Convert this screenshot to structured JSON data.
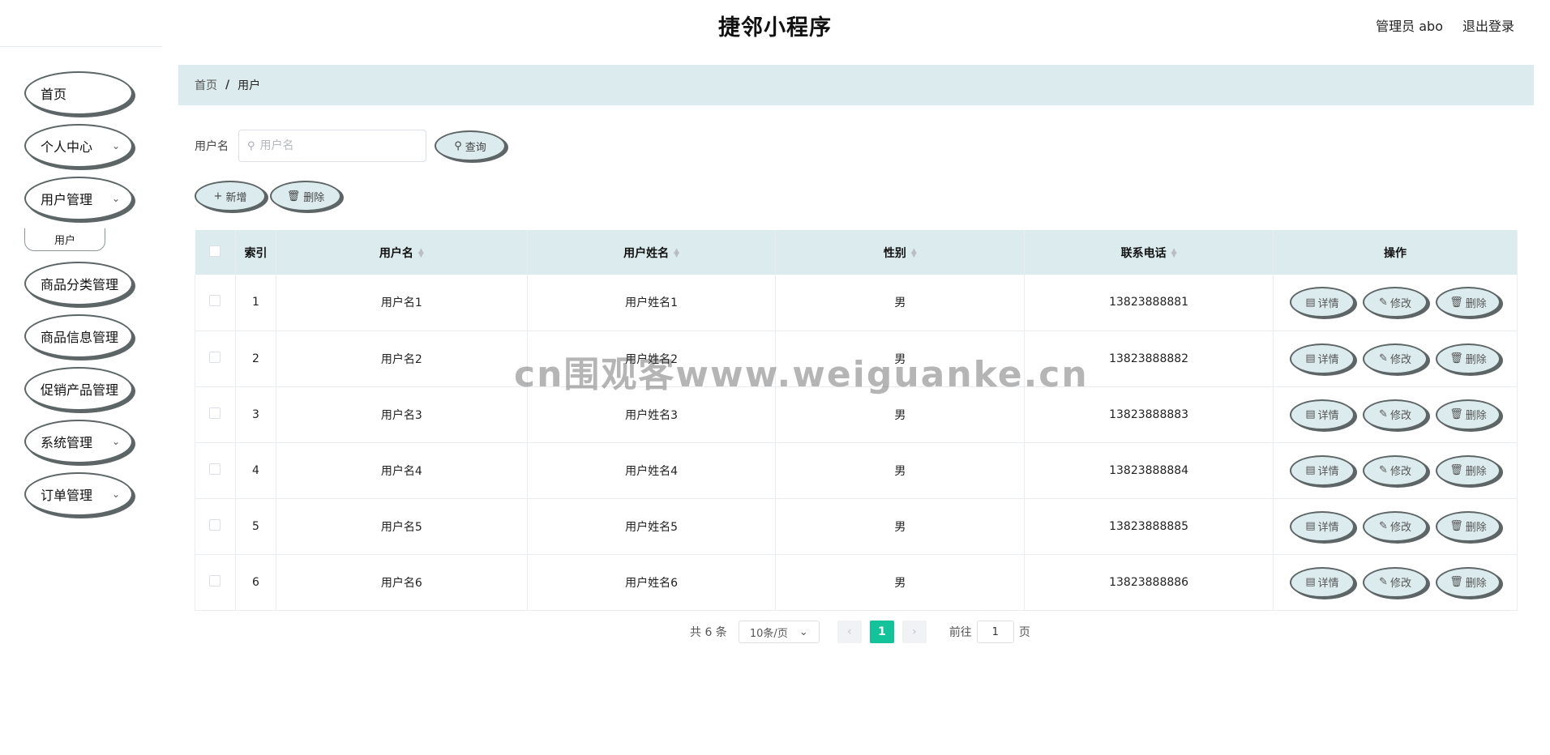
{
  "header": {
    "title": "捷邻小程序",
    "admin_label": "管理员 abo",
    "logout_label": "退出登录"
  },
  "sidebar": {
    "items": [
      {
        "label": "首页",
        "expandable": false
      },
      {
        "label": "个人中心",
        "expandable": true
      },
      {
        "label": "用户管理",
        "expandable": true
      },
      {
        "label": "商品分类管理",
        "expandable": false
      },
      {
        "label": "商品信息管理",
        "expandable": false
      },
      {
        "label": "促销产品管理",
        "expandable": false
      },
      {
        "label": "系统管理",
        "expandable": true
      },
      {
        "label": "订单管理",
        "expandable": true
      }
    ],
    "submenu_label": "用户"
  },
  "breadcrumb": {
    "home": "首页",
    "separator": "/",
    "current": "用户"
  },
  "search": {
    "label": "用户名",
    "placeholder": "用户名",
    "value": "",
    "query_label": "查询"
  },
  "actions": {
    "add_label": "新增",
    "delete_label": "删除"
  },
  "table": {
    "columns": [
      "索引",
      "用户名",
      "用户姓名",
      "性别",
      "联系电话",
      "操作"
    ],
    "rows": [
      {
        "index": "1",
        "username": "用户名1",
        "realname": "用户姓名1",
        "gender": "男",
        "phone": "13823888881"
      },
      {
        "index": "2",
        "username": "用户名2",
        "realname": "用户姓名2",
        "gender": "男",
        "phone": "13823888882"
      },
      {
        "index": "3",
        "username": "用户名3",
        "realname": "用户姓名3",
        "gender": "男",
        "phone": "13823888883"
      },
      {
        "index": "4",
        "username": "用户名4",
        "realname": "用户姓名4",
        "gender": "男",
        "phone": "13823888884"
      },
      {
        "index": "5",
        "username": "用户名5",
        "realname": "用户姓名5",
        "gender": "男",
        "phone": "13823888885"
      },
      {
        "index": "6",
        "username": "用户名6",
        "realname": "用户姓名6",
        "gender": "男",
        "phone": "13823888886"
      }
    ],
    "ops": {
      "detail": "详情",
      "edit": "修改",
      "delete": "删除"
    }
  },
  "pagination": {
    "total": "共 6 条",
    "page_size": "10条/页",
    "current_page": "1",
    "goto_label": "前往",
    "goto_value": "1",
    "page_unit": "页"
  },
  "watermark": "cn围观客www.weiguanke.cn",
  "colors": {
    "accent": "#14c39a",
    "panel": "#dcebed",
    "border": "#5d6566"
  }
}
